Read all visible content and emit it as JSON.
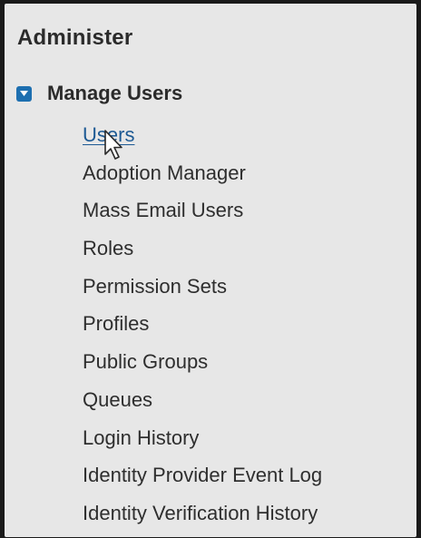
{
  "panel": {
    "title": "Administer"
  },
  "section": {
    "label": "Manage Users",
    "toggle_state": "expanded",
    "toggle_color": "#1d6fb0"
  },
  "menu": {
    "items": [
      {
        "label": "Users",
        "active": true
      },
      {
        "label": "Adoption Manager",
        "active": false
      },
      {
        "label": "Mass Email Users",
        "active": false
      },
      {
        "label": "Roles",
        "active": false
      },
      {
        "label": "Permission Sets",
        "active": false
      },
      {
        "label": "Profiles",
        "active": false
      },
      {
        "label": "Public Groups",
        "active": false
      },
      {
        "label": "Queues",
        "active": false
      },
      {
        "label": "Login History",
        "active": false
      },
      {
        "label": "Identity Provider Event Log",
        "active": false
      },
      {
        "label": "Identity Verification History",
        "active": false
      }
    ]
  },
  "colors": {
    "link_active": "#1d5a94",
    "panel_bg": "#e7e7e7",
    "text": "#2e2e2e"
  }
}
